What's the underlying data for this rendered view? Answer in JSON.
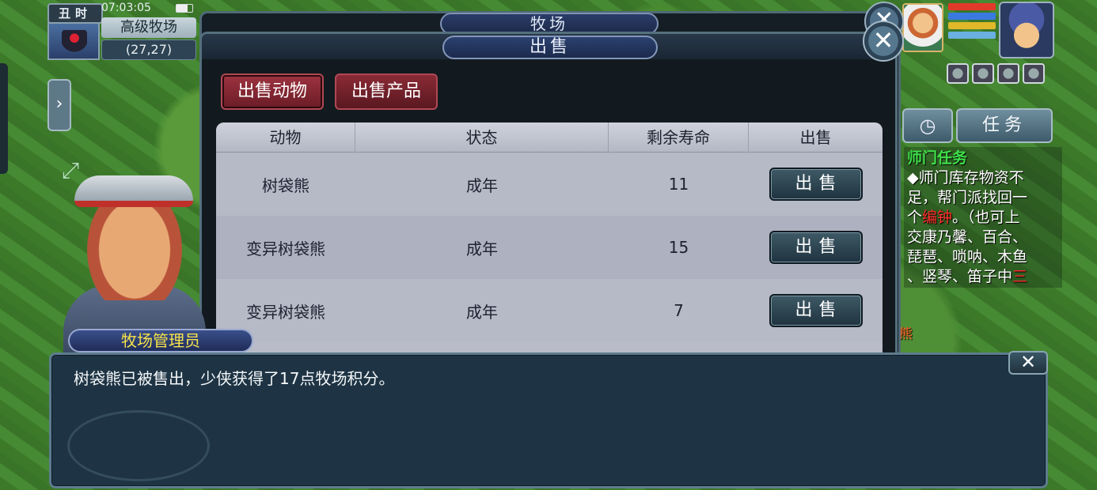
{
  "hud": {
    "shichen": "丑时",
    "time": "07:03:05",
    "map_name": "高级牧场",
    "coords": "(27,27)"
  },
  "colors": {
    "hp": "#e23a2a",
    "mp": "#3a7ae0",
    "exp": "#e0b82a",
    "extra": "#6ab0e0",
    "tab_active": "#9e3340",
    "npc_name": "#f6e34a"
  },
  "icons": {
    "side_arrow": "chevron-right",
    "expand": "expand-arrows",
    "timer": "clock",
    "close": "close-x"
  },
  "right_hud": {
    "task_button": "任务",
    "task_panel": {
      "title": "师门任务",
      "line1": "◆师门库存物资不",
      "line2": "足，帮门派找回一",
      "line3_pre": "个",
      "line3_item": "编钟",
      "line3_post": "。（也可上",
      "line4": "交康乃馨、百合、",
      "line5": "琵琶、唢呐、木鱼",
      "line6_pre": "、竖琴、笛子中",
      "line6_red": "三"
    },
    "fragment": "熊"
  },
  "back_panel": {
    "title": "牧场"
  },
  "panel": {
    "title": "出售",
    "tabs": [
      "出售动物",
      "出售产品"
    ],
    "columns": [
      "动物",
      "状态",
      "剩余寿命",
      "出售"
    ],
    "rows": [
      {
        "animal": "树袋熊",
        "status": "成年",
        "life": "11",
        "button": "出售"
      },
      {
        "animal": "变异树袋熊",
        "status": "成年",
        "life": "15",
        "button": "出售"
      },
      {
        "animal": "变异树袋熊",
        "status": "成年",
        "life": "7",
        "button": "出售"
      }
    ]
  },
  "npc": {
    "name": "牧场管理员"
  },
  "dialog": {
    "text": "树袋熊已被售出，少侠获得了17点牧场积分。"
  }
}
